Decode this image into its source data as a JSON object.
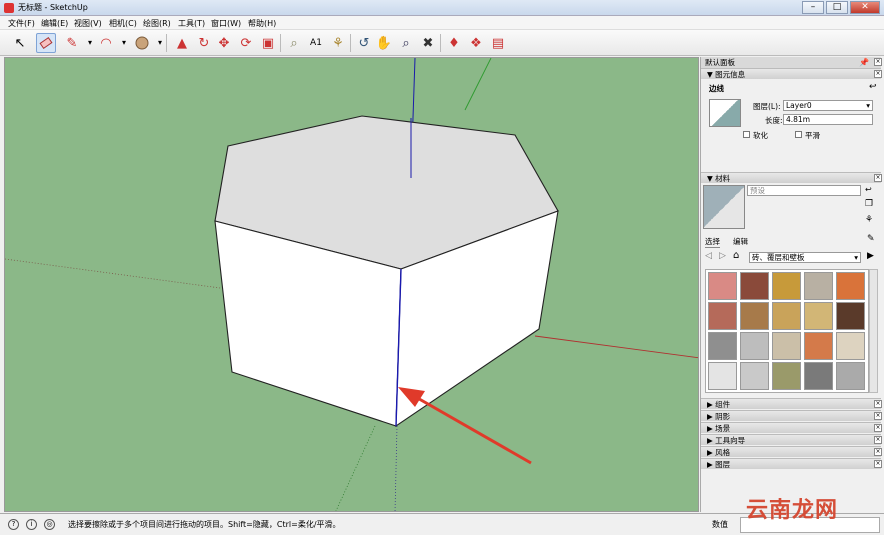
{
  "window": {
    "title": "无标题 - SketchUp"
  },
  "menu": [
    "文件(F)",
    "编辑(E)",
    "视图(V)",
    "相机(C)",
    "绘图(R)",
    "工具(T)",
    "窗口(W)",
    "帮助(H)"
  ],
  "toolbar": {
    "icons": [
      "select-icon",
      "eraser-icon",
      "pencil-icon",
      "arc-icon",
      "paint-bucket-icon",
      "push-pull-icon",
      "follow-me-icon",
      "move-icon",
      "rotate-icon",
      "scale-icon",
      "tape-measure-icon",
      "text-icon",
      "paint-icon",
      "orbit-icon",
      "pan-icon",
      "zoom-icon",
      "zoom-extents-icon",
      "warehouse-icon",
      "components-icon",
      "share-icon"
    ]
  },
  "panel": {
    "tray_title": "默认面板",
    "entity_info": {
      "header": "图元信息",
      "type": "边线",
      "layer_label": "图层(L):",
      "layer_value": "Layer0",
      "length_label": "长度:",
      "length_value": "4.81m",
      "soften_label": "软化",
      "smooth_label": "平滑"
    },
    "materials": {
      "header": "材料",
      "name_placeholder": "预设",
      "tab_select": "选择",
      "tab_edit": "编辑",
      "category": "砖、覆层和壁板",
      "swatch_colors": [
        "#d98a85",
        "#8a4a3a",
        "#c79a3a",
        "#b8b0a3",
        "#d9733a",
        "#b56a5a",
        "#a77a4a",
        "#c9a35a",
        "#d2b676",
        "#5a3a2a",
        "#8f8f8f",
        "#bdbdbd",
        "#cbbfa8",
        "#d47a4a",
        "#ddd3c0",
        "#e4e4e4",
        "#c9c9c9",
        "#9a9a6a",
        "#7a7a7a",
        "#aaaaaa"
      ]
    },
    "collapsed": [
      "组件",
      "阴影",
      "场景",
      "工具向导",
      "风格",
      "图层"
    ]
  },
  "status": {
    "text": "选择要擦除或于多个项目间进行拖动的项目。Shift=隐藏，Ctrl=柔化/平滑。",
    "measure_label": "数值"
  },
  "watermark": "云南龙网"
}
